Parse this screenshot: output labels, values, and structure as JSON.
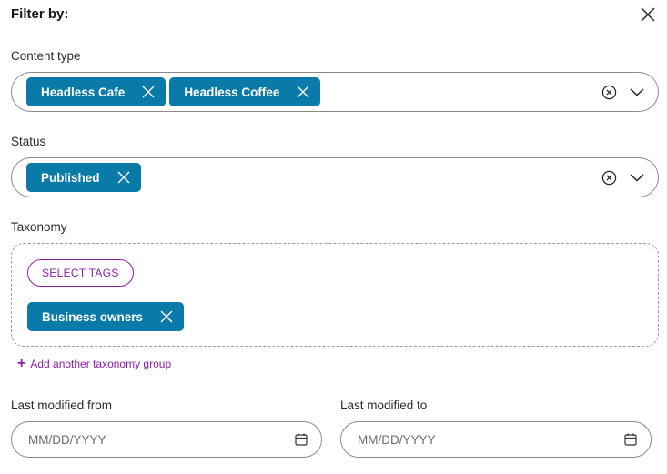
{
  "panel": {
    "title": "Filter by:",
    "close_icon": "close-icon"
  },
  "content_type": {
    "label": "Content type",
    "chips": [
      "Headless Cafe",
      "Headless Coffee"
    ]
  },
  "status": {
    "label": "Status",
    "chips": [
      "Published"
    ]
  },
  "taxonomy": {
    "label": "Taxonomy",
    "select_tags_label": "SELECT TAGS",
    "chips": [
      "Business owners"
    ],
    "add_group_label": "Add another taxonomy group"
  },
  "last_modified_from": {
    "label": "Last modified from",
    "placeholder": "MM/DD/YYYY"
  },
  "last_modified_to": {
    "label": "Last modified to",
    "placeholder": "MM/DD/YYYY"
  },
  "colors": {
    "chip": "#0a7aa8",
    "accent": "#8b1fa8",
    "border": "#8a8a8a"
  }
}
